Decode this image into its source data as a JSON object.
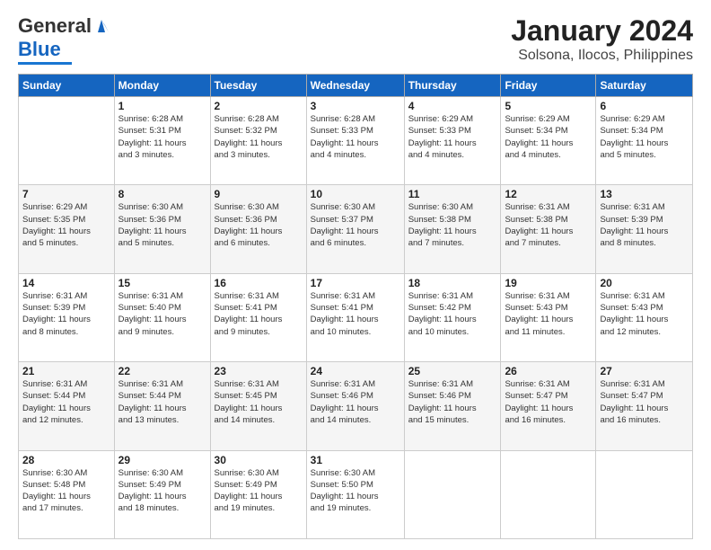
{
  "logo": {
    "line1": "General",
    "line2": "Blue"
  },
  "title": "January 2024",
  "subtitle": "Solsona, Ilocos, Philippines",
  "headers": [
    "Sunday",
    "Monday",
    "Tuesday",
    "Wednesday",
    "Thursday",
    "Friday",
    "Saturday"
  ],
  "weeks": [
    [
      {
        "day": "",
        "info": ""
      },
      {
        "day": "1",
        "info": "Sunrise: 6:28 AM\nSunset: 5:31 PM\nDaylight: 11 hours\nand 3 minutes."
      },
      {
        "day": "2",
        "info": "Sunrise: 6:28 AM\nSunset: 5:32 PM\nDaylight: 11 hours\nand 3 minutes."
      },
      {
        "day": "3",
        "info": "Sunrise: 6:28 AM\nSunset: 5:33 PM\nDaylight: 11 hours\nand 4 minutes."
      },
      {
        "day": "4",
        "info": "Sunrise: 6:29 AM\nSunset: 5:33 PM\nDaylight: 11 hours\nand 4 minutes."
      },
      {
        "day": "5",
        "info": "Sunrise: 6:29 AM\nSunset: 5:34 PM\nDaylight: 11 hours\nand 4 minutes."
      },
      {
        "day": "6",
        "info": "Sunrise: 6:29 AM\nSunset: 5:34 PM\nDaylight: 11 hours\nand 5 minutes."
      }
    ],
    [
      {
        "day": "7",
        "info": "Sunrise: 6:29 AM\nSunset: 5:35 PM\nDaylight: 11 hours\nand 5 minutes."
      },
      {
        "day": "8",
        "info": "Sunrise: 6:30 AM\nSunset: 5:36 PM\nDaylight: 11 hours\nand 5 minutes."
      },
      {
        "day": "9",
        "info": "Sunrise: 6:30 AM\nSunset: 5:36 PM\nDaylight: 11 hours\nand 6 minutes."
      },
      {
        "day": "10",
        "info": "Sunrise: 6:30 AM\nSunset: 5:37 PM\nDaylight: 11 hours\nand 6 minutes."
      },
      {
        "day": "11",
        "info": "Sunrise: 6:30 AM\nSunset: 5:38 PM\nDaylight: 11 hours\nand 7 minutes."
      },
      {
        "day": "12",
        "info": "Sunrise: 6:31 AM\nSunset: 5:38 PM\nDaylight: 11 hours\nand 7 minutes."
      },
      {
        "day": "13",
        "info": "Sunrise: 6:31 AM\nSunset: 5:39 PM\nDaylight: 11 hours\nand 8 minutes."
      }
    ],
    [
      {
        "day": "14",
        "info": "Sunrise: 6:31 AM\nSunset: 5:39 PM\nDaylight: 11 hours\nand 8 minutes."
      },
      {
        "day": "15",
        "info": "Sunrise: 6:31 AM\nSunset: 5:40 PM\nDaylight: 11 hours\nand 9 minutes."
      },
      {
        "day": "16",
        "info": "Sunrise: 6:31 AM\nSunset: 5:41 PM\nDaylight: 11 hours\nand 9 minutes."
      },
      {
        "day": "17",
        "info": "Sunrise: 6:31 AM\nSunset: 5:41 PM\nDaylight: 11 hours\nand 10 minutes."
      },
      {
        "day": "18",
        "info": "Sunrise: 6:31 AM\nSunset: 5:42 PM\nDaylight: 11 hours\nand 10 minutes."
      },
      {
        "day": "19",
        "info": "Sunrise: 6:31 AM\nSunset: 5:43 PM\nDaylight: 11 hours\nand 11 minutes."
      },
      {
        "day": "20",
        "info": "Sunrise: 6:31 AM\nSunset: 5:43 PM\nDaylight: 11 hours\nand 12 minutes."
      }
    ],
    [
      {
        "day": "21",
        "info": "Sunrise: 6:31 AM\nSunset: 5:44 PM\nDaylight: 11 hours\nand 12 minutes."
      },
      {
        "day": "22",
        "info": "Sunrise: 6:31 AM\nSunset: 5:44 PM\nDaylight: 11 hours\nand 13 minutes."
      },
      {
        "day": "23",
        "info": "Sunrise: 6:31 AM\nSunset: 5:45 PM\nDaylight: 11 hours\nand 14 minutes."
      },
      {
        "day": "24",
        "info": "Sunrise: 6:31 AM\nSunset: 5:46 PM\nDaylight: 11 hours\nand 14 minutes."
      },
      {
        "day": "25",
        "info": "Sunrise: 6:31 AM\nSunset: 5:46 PM\nDaylight: 11 hours\nand 15 minutes."
      },
      {
        "day": "26",
        "info": "Sunrise: 6:31 AM\nSunset: 5:47 PM\nDaylight: 11 hours\nand 16 minutes."
      },
      {
        "day": "27",
        "info": "Sunrise: 6:31 AM\nSunset: 5:47 PM\nDaylight: 11 hours\nand 16 minutes."
      }
    ],
    [
      {
        "day": "28",
        "info": "Sunrise: 6:30 AM\nSunset: 5:48 PM\nDaylight: 11 hours\nand 17 minutes."
      },
      {
        "day": "29",
        "info": "Sunrise: 6:30 AM\nSunset: 5:49 PM\nDaylight: 11 hours\nand 18 minutes."
      },
      {
        "day": "30",
        "info": "Sunrise: 6:30 AM\nSunset: 5:49 PM\nDaylight: 11 hours\nand 19 minutes."
      },
      {
        "day": "31",
        "info": "Sunrise: 6:30 AM\nSunset: 5:50 PM\nDaylight: 11 hours\nand 19 minutes."
      },
      {
        "day": "",
        "info": ""
      },
      {
        "day": "",
        "info": ""
      },
      {
        "day": "",
        "info": ""
      }
    ]
  ]
}
